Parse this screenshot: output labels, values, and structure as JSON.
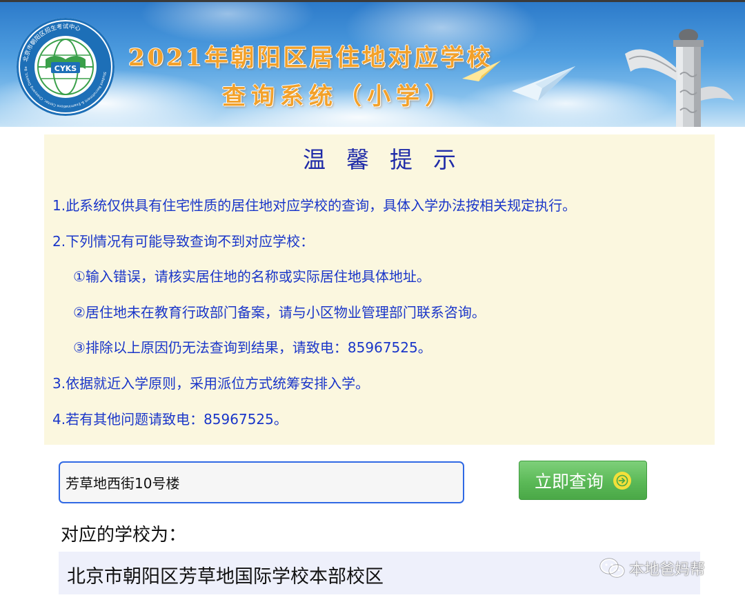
{
  "banner": {
    "title_line1": "2021年朝阳区居住地对应学校",
    "title_line2": "查询系统（小学）",
    "logo": {
      "center_text": "CYKS",
      "ring_text": "北京市朝阳区招生考试中心",
      "ring_text_en": "Student Recruitment & Examinations Center, Chaoyang District, Beijing"
    }
  },
  "tips": {
    "heading": "温馨提示",
    "items": [
      "1.此系统仅供具有住宅性质的居住地对应学校的查询，具体入学办法按相关规定执行。",
      "2.下列情况有可能导致查询不到对应学校：",
      "①输入错误，请核实居住地的名称或实际居住地具体地址。",
      "②居住地未在教育行政部门备案，请与小区物业管理部门联系咨询。",
      "③排除以上原因仍无法查询到结果，请致电：85967525。",
      "3.依据就近入学原则，采用派位方式统筹安排入学。",
      "4.若有其他问题请致电：85967525。"
    ]
  },
  "search": {
    "value": "芳草地西街10号楼",
    "button_label": "立即查询",
    "button_icon": "arrow-right-circle-icon"
  },
  "result": {
    "label": "对应的学校为：",
    "value": "北京市朝阳区芳草地国际学校本部校区"
  },
  "watermark": {
    "text": "本地爸妈帮",
    "icon": "wechat-icon"
  },
  "colors": {
    "tips_text": "#1a36c9",
    "tips_bg": "#fbf7df",
    "input_border": "#2f68e4",
    "button_green": "#5bb957",
    "result_bg": "#eef0fb",
    "banner_title": "#f2a12b"
  }
}
